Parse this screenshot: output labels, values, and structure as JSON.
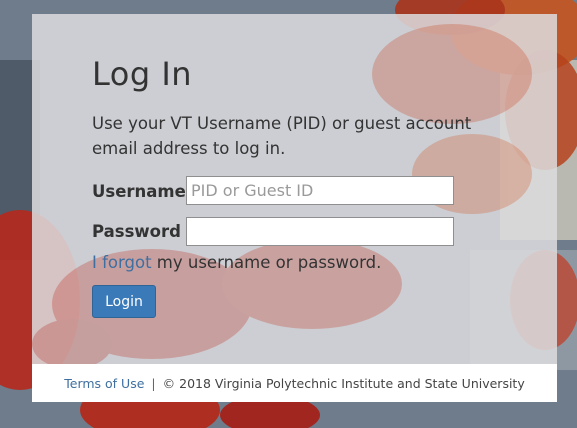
{
  "login": {
    "title": "Log In",
    "intro": "Use your VT Username (PID) or guest account email address to log in.",
    "username_label": "Username",
    "username_placeholder": "PID or Guest ID",
    "username_value": "",
    "password_label": "Password",
    "password_value": "",
    "forgot_link": "I forgot",
    "forgot_rest": " my username or password.",
    "login_button": "Login"
  },
  "footer": {
    "terms_link": "Terms of Use",
    "separator": "|",
    "copyright": "© 2018 Virginia Polytechnic Institute and State University"
  },
  "colors": {
    "link": "#3e6fa0",
    "button": "#3a7ab8",
    "leaves": "#c0301e"
  }
}
